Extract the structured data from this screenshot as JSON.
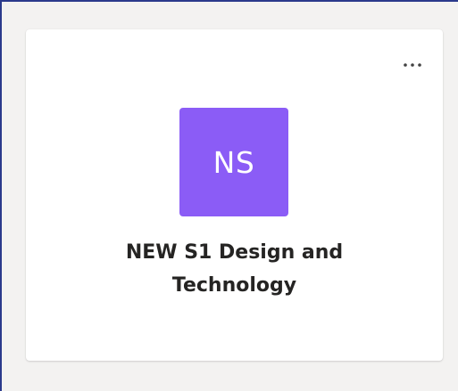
{
  "team_card": {
    "initials": "NS",
    "name": "NEW S1 Design and Technology",
    "more_icon": "more-horizontal-icon"
  },
  "colors": {
    "avatar_bg": "#8b5cf6",
    "card_bg": "#ffffff",
    "page_bg": "#f3f2f1",
    "frame_border": "#2b3a8c",
    "text": "#252423",
    "icon": "#424242"
  }
}
